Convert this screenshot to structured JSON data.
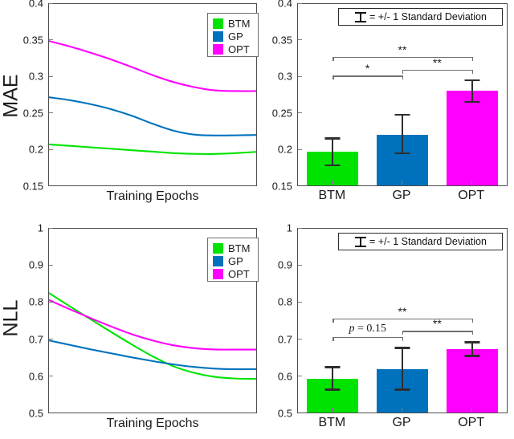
{
  "figure": {
    "colors": {
      "btm": "#00e300",
      "gp": "#0072bd",
      "opt": "#ff00ff",
      "axis": "#4d4d4d",
      "error": "#2e2e2e",
      "signif": "#6f6f6f"
    }
  },
  "legend": {
    "items": [
      {
        "label": "BTM",
        "color": "#00e300"
      },
      {
        "label": "GP",
        "color": "#0072bd"
      },
      {
        "label": "OPT",
        "color": "#ff00ff"
      }
    ]
  },
  "sd_note": {
    "icon": "errorbar-icon",
    "text": "= +/- 1 Standard Deviation"
  },
  "chart_data": [
    {
      "id": "mae-training-curve",
      "type": "line",
      "title": "",
      "xlabel": "Training Epochs",
      "ylabel": "MAE",
      "ylim": [
        0.15,
        0.4
      ],
      "yticks": [
        "0.15",
        "0.2",
        "0.25",
        "0.3",
        "0.35",
        "0.4"
      ],
      "ytickvals": [
        0.15,
        0.2,
        0.25,
        0.3,
        0.35,
        0.4
      ],
      "xlim": [
        0,
        1
      ],
      "xticks": [],
      "grid": false,
      "legend_position": "top-right",
      "series": [
        {
          "name": "BTM",
          "color": "#00e300",
          "x": [
            0,
            0.1,
            0.2,
            0.3,
            0.4,
            0.5,
            0.6,
            0.7,
            0.8,
            0.9,
            1.0
          ],
          "values": [
            0.2065,
            0.2045,
            0.2025,
            0.2005,
            0.1985,
            0.1965,
            0.1945,
            0.1935,
            0.1933,
            0.1945,
            0.1962
          ]
        },
        {
          "name": "GP",
          "color": "#0072bd",
          "x": [
            0,
            0.1,
            0.2,
            0.3,
            0.4,
            0.5,
            0.6,
            0.7,
            0.8,
            0.9,
            1.0
          ],
          "values": [
            0.2715,
            0.2675,
            0.262,
            0.255,
            0.246,
            0.235,
            0.2255,
            0.22,
            0.2188,
            0.219,
            0.2195
          ]
        },
        {
          "name": "OPT",
          "color": "#ff00ff",
          "x": [
            0,
            0.1,
            0.2,
            0.3,
            0.4,
            0.5,
            0.6,
            0.7,
            0.8,
            0.9,
            1.0
          ],
          "values": [
            0.349,
            0.3415,
            0.333,
            0.3235,
            0.313,
            0.302,
            0.2925,
            0.2855,
            0.281,
            0.28,
            0.28
          ]
        }
      ]
    },
    {
      "id": "mae-summary-bars",
      "type": "bar",
      "title": "",
      "xlabel": "",
      "ylabel": "",
      "ylim": [
        0.15,
        0.4
      ],
      "yticks": [
        "0.15",
        "0.2",
        "0.25",
        "0.3",
        "0.35",
        "0.4"
      ],
      "ytickvals": [
        0.15,
        0.2,
        0.25,
        0.3,
        0.35,
        0.4
      ],
      "categories": [
        "BTM",
        "GP",
        "OPT"
      ],
      "values": [
        0.196,
        0.22,
        0.28
      ],
      "errors_low": [
        0.176,
        0.193,
        0.264
      ],
      "errors_high": [
        0.216,
        0.249,
        0.296
      ],
      "colors": [
        "#00e300",
        "#0072bd",
        "#ff00ff"
      ],
      "annotations": [
        {
          "from": "BTM",
          "to": "OPT",
          "label": "**",
          "y": 0.327
        },
        {
          "from": "BTM",
          "to": "GP",
          "label": "*",
          "y": 0.301
        },
        {
          "from": "GP",
          "to": "OPT",
          "label": "**",
          "y": 0.309
        }
      ]
    },
    {
      "id": "nll-training-curve",
      "type": "line",
      "title": "",
      "xlabel": "Training Epochs",
      "ylabel": "NLL",
      "ylim": [
        0.5,
        1.0
      ],
      "yticks": [
        "0.5",
        "0.6",
        "0.7",
        "0.8",
        "0.9",
        "1"
      ],
      "ytickvals": [
        0.5,
        0.6,
        0.7,
        0.8,
        0.9,
        1.0
      ],
      "xlim": [
        0,
        1
      ],
      "xticks": [],
      "grid": false,
      "legend_position": "top-right",
      "series": [
        {
          "name": "BTM",
          "color": "#00e300",
          "x": [
            0,
            0.1,
            0.2,
            0.3,
            0.4,
            0.5,
            0.6,
            0.7,
            0.8,
            0.9,
            1.0
          ],
          "values": [
            0.825,
            0.789,
            0.754,
            0.719,
            0.685,
            0.653,
            0.626,
            0.608,
            0.597,
            0.5925,
            0.5915
          ]
        },
        {
          "name": "GP",
          "color": "#0072bd",
          "x": [
            0,
            0.1,
            0.2,
            0.3,
            0.4,
            0.5,
            0.6,
            0.7,
            0.8,
            0.9,
            1.0
          ],
          "values": [
            0.696,
            0.684,
            0.672,
            0.661,
            0.65,
            0.64,
            0.631,
            0.624,
            0.6195,
            0.6178,
            0.618
          ]
        },
        {
          "name": "OPT",
          "color": "#ff00ff",
          "x": [
            0,
            0.1,
            0.2,
            0.3,
            0.4,
            0.5,
            0.6,
            0.7,
            0.8,
            0.9,
            1.0
          ],
          "values": [
            0.806,
            0.781,
            0.757,
            0.734,
            0.713,
            0.696,
            0.683,
            0.675,
            0.6715,
            0.6712,
            0.6712
          ]
        }
      ]
    },
    {
      "id": "nll-summary-bars",
      "type": "bar",
      "title": "",
      "xlabel": "",
      "ylabel": "",
      "ylim": [
        0.5,
        1.0
      ],
      "yticks": [
        "0.5",
        "0.6",
        "0.7",
        "0.8",
        "0.9",
        "1"
      ],
      "ytickvals": [
        0.5,
        0.6,
        0.7,
        0.8,
        0.9,
        1.0
      ],
      "categories": [
        "BTM",
        "GP",
        "OPT"
      ],
      "values": [
        0.592,
        0.617,
        0.672
      ],
      "errors_low": [
        0.56,
        0.56,
        0.651
      ],
      "errors_high": [
        0.626,
        0.678,
        0.694
      ],
      "colors": [
        "#00e300",
        "#0072bd",
        "#ff00ff"
      ],
      "annotations": [
        {
          "from": "BTM",
          "to": "OPT",
          "label": "**",
          "y": 0.755
        },
        {
          "from": "BTM",
          "to": "GP",
          "label": "p = 0.15",
          "y": 0.705
        },
        {
          "from": "GP",
          "to": "OPT",
          "label": "**",
          "y": 0.722
        }
      ]
    }
  ]
}
